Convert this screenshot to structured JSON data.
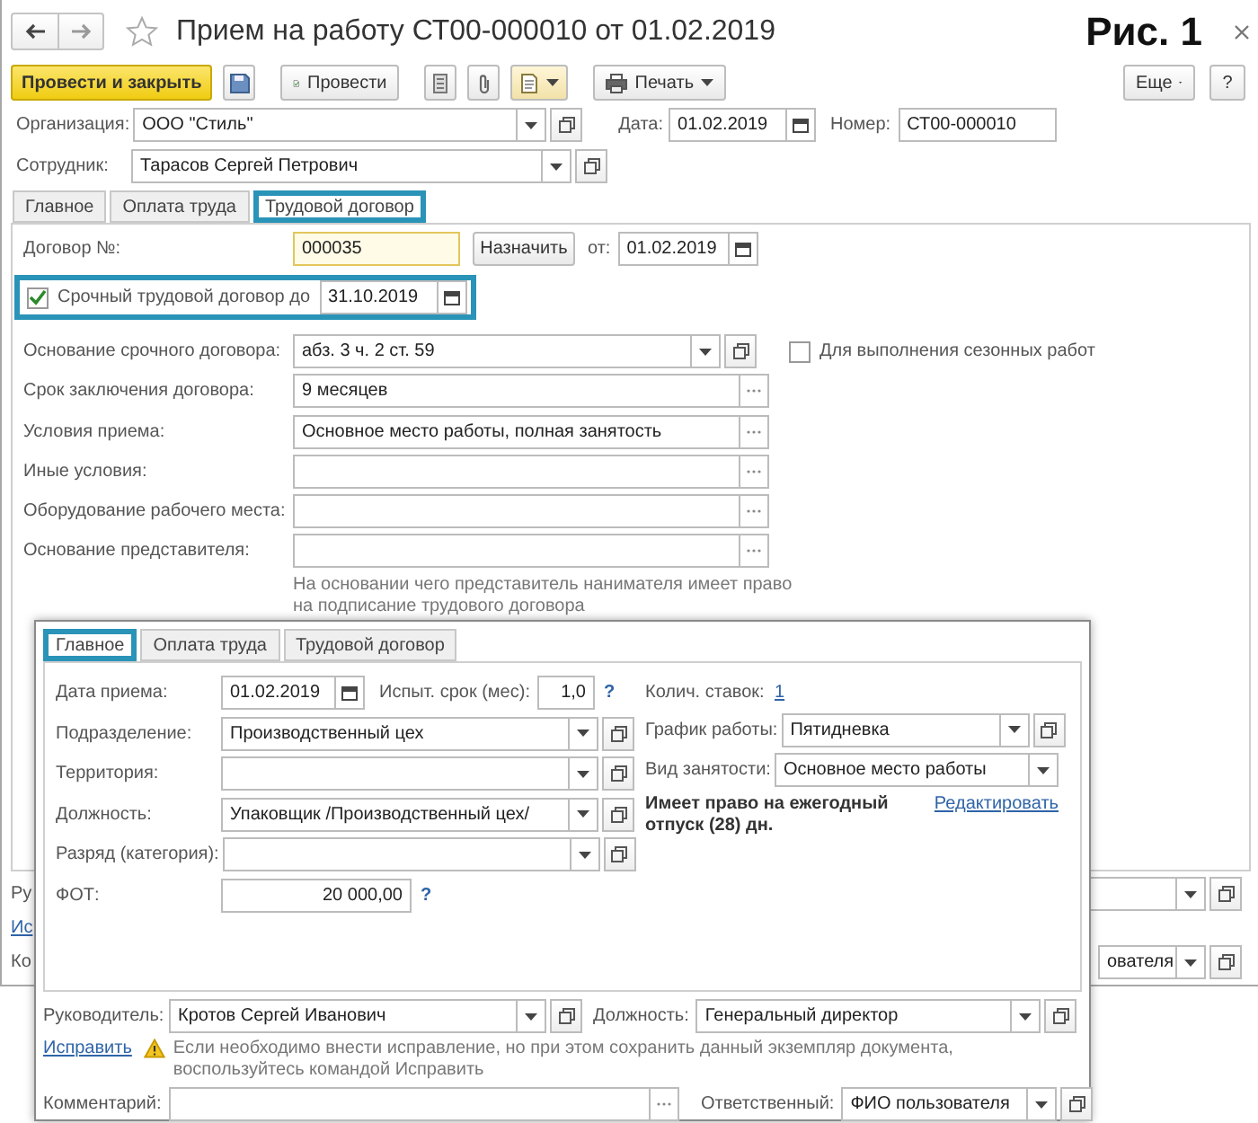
{
  "figure_label": "Рис. 1",
  "window": {
    "title": "Прием на работу СТ00-000010 от 01.02.2019"
  },
  "toolbar": {
    "post_and_close": "Провести и закрыть",
    "post": "Провести",
    "print": "Печать",
    "more": "Еще",
    "help": "?"
  },
  "header": [
    {
      "label": "Организация:",
      "value": "ООО \"Стиль\"",
      "kind": "select"
    },
    {
      "label": "Дата:",
      "value": "01.02.2019",
      "kind": "date"
    },
    {
      "label": "Номер:",
      "value": "СТ00-000010",
      "kind": "text"
    },
    {
      "label": "Сотрудник:",
      "value": "Тарасов Сергей Петрович",
      "kind": "select"
    }
  ],
  "tabs": [
    {
      "label": "Главное",
      "selected": false
    },
    {
      "label": "Оплата труда",
      "selected": false
    },
    {
      "label": "Трудовой договор",
      "selected": true
    }
  ],
  "contract": {
    "number": {
      "label": "Договор №:",
      "value": "000035",
      "kind": "text",
      "focused": true
    },
    "assign_button": "Назначить",
    "from": {
      "label": "от:",
      "value": "01.02.2019",
      "kind": "date"
    },
    "fixed_term": {
      "label": "Срочный трудовой договор до",
      "checked": true,
      "highlighted": true,
      "date": {
        "value": "31.10.2019",
        "kind": "date"
      }
    },
    "fields": [
      {
        "label": "Основание срочного договора:",
        "value": "абз. 3 ч. 2 ст. 59",
        "kind": "select"
      },
      {
        "label": "Срок заключения договора:",
        "value": "9 месяцев",
        "kind": "dots"
      },
      {
        "label": "Условия приема:",
        "value": "Основное место работы, полная занятость",
        "kind": "dots"
      },
      {
        "label": "Иные условия:",
        "kind": "dots"
      },
      {
        "label": "Оборудование рабочего места:",
        "kind": "dots"
      },
      {
        "label": "Основание представителя:",
        "kind": "dots"
      }
    ],
    "seasonal": {
      "label": "Для выполнения сезонных работ",
      "checked": false
    },
    "hint": "На основании чего представитель нанимателя имеет право на подписание трудового договора"
  },
  "background_rows": {
    "label_1": "Ру",
    "link": "Ис",
    "label_2": "Ко",
    "field_value": "ователя"
  },
  "dialog": {
    "tabs": [
      {
        "label": "Главное",
        "selected": true
      },
      {
        "label": "Оплата труда",
        "selected": false
      },
      {
        "label": "Трудовой договор",
        "selected": false
      }
    ],
    "hire_date": {
      "label": "Дата приема:",
      "value": "01.02.2019",
      "kind": "date"
    },
    "probation": {
      "label": "Испыт. срок (мес):",
      "value": "1,0",
      "kind": "number",
      "help": "?"
    },
    "left_fields": [
      {
        "label": "Подразделение:",
        "value": "Производственный цех",
        "kind": "select"
      },
      {
        "label": "Территория:",
        "kind": "select"
      },
      {
        "label": "Должность:",
        "value": "Упаковщик /Производственный цех/",
        "kind": "select"
      },
      {
        "label": "Разряд (категория):",
        "kind": "select"
      }
    ],
    "salary": {
      "label": "ФОТ:",
      "value": "20 000,00",
      "kind": "number",
      "help": "?"
    },
    "rates": {
      "label": "Колич. ставок:",
      "value": "1"
    },
    "right_fields": [
      {
        "label": "График работы:",
        "value": "Пятидневка",
        "kind": "select"
      },
      {
        "label": "Вид занятости:",
        "value": "Основное место работы",
        "kind": "choice"
      }
    ],
    "vacation_note": "Имеет право на ежегодный отпуск (28) дн.",
    "edit_link": "Редактировать",
    "manager": {
      "label": "Руководитель:",
      "value": "Кротов Сергей Иванович",
      "kind": "select"
    },
    "manager_position": {
      "label": "Должность:",
      "value": "Генеральный директор",
      "kind": "select"
    },
    "fix_link": "Исправить",
    "warning": "Если необходимо внести исправление, но при этом сохранить данный экземпляр документа, воспользуйтесь командой Исправить",
    "comment": {
      "label": "Комментарий:",
      "kind": "dots"
    },
    "responsible": {
      "label": "Ответственный:",
      "value": "ФИО пользователя",
      "kind": "select"
    }
  }
}
